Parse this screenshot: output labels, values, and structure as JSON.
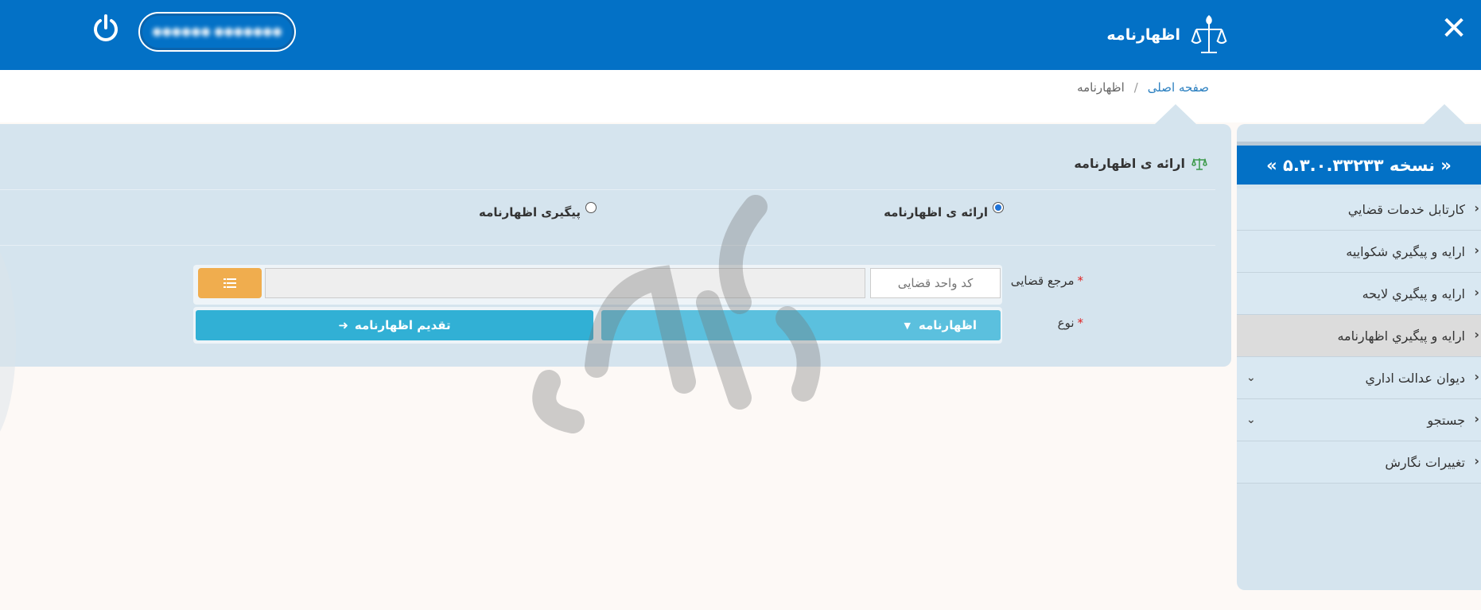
{
  "header": {
    "title": "اظهارنامه",
    "close_icon": "close-icon",
    "logo_icon": "scales-logo-icon",
    "user_label": "●●●●●● ●●●●●●●",
    "power_icon": "power-icon"
  },
  "breadcrumb": {
    "home": "صفحه اصلی",
    "separator": "/",
    "current": "اظهارنامه"
  },
  "sidebar": {
    "version": "« نسخه ۵.۳.۰.۳۳۲۳۳ »",
    "items": [
      {
        "label": "كارتابل خدمات قضايي",
        "expandable": false,
        "active": false
      },
      {
        "label": "ارايه و پيگيري شكواييه",
        "expandable": false,
        "active": false
      },
      {
        "label": "ارايه و پيگيري لايحه",
        "expandable": false,
        "active": false
      },
      {
        "label": "ارايه و پيگيري اظهارنامه",
        "expandable": false,
        "active": true
      },
      {
        "label": "ديوان عدالت اداري",
        "expandable": true,
        "active": false
      },
      {
        "label": "جستجو",
        "expandable": true,
        "active": false
      },
      {
        "label": "تغییرات نگارش",
        "expandable": false,
        "active": false
      }
    ]
  },
  "main": {
    "title": "ارائه ی اظهارنامه",
    "radio_submit": "ارائه ی اظهارنامه",
    "radio_track": "پیگیری اظهارنامه",
    "judicial_ref_label": "مرجع قضایی",
    "judicial_code_placeholder": "کد واحد قضایی",
    "type_label": "نوع",
    "type_selected": "اظهارنامه",
    "submit_button": "تقدیم اظهارنامه"
  },
  "colors": {
    "header_bg": "#0371c6",
    "panel_bg": "#d5e4ee",
    "orange": "#f0ad4e",
    "select_bg": "#5bc0de",
    "submit_bg": "#31b0d5"
  }
}
